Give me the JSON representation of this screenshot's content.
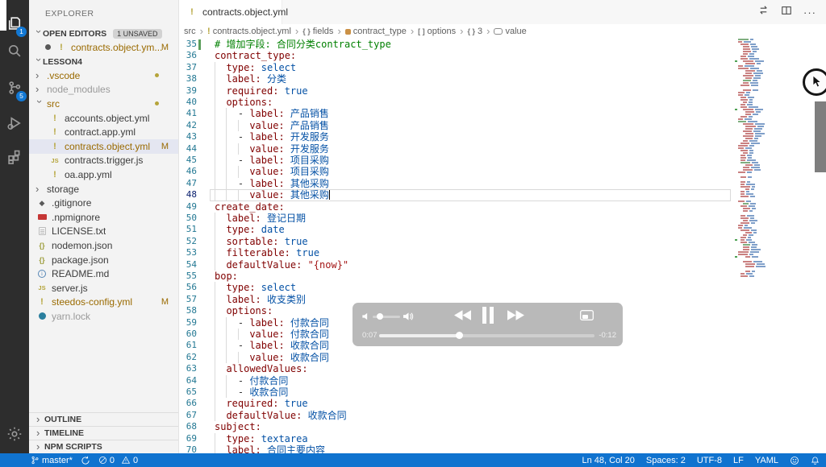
{
  "colors": {
    "status_bar": "#1073cf",
    "activity_badge": "#1278d4",
    "modified": "#9a6a00",
    "comment": "#008000",
    "key": "#800000",
    "value": "#0451a5",
    "string": "#a31515",
    "selection_bg": "#e4e6f1"
  },
  "activity_bar": {
    "items": [
      {
        "name": "explorer",
        "badge": "1",
        "active": true
      },
      {
        "name": "search"
      },
      {
        "name": "source-control",
        "badge": "5"
      },
      {
        "name": "run-debug"
      },
      {
        "name": "extensions"
      }
    ],
    "settings": "gear"
  },
  "sidebar": {
    "title": "EXPLORER",
    "open_editors": {
      "label": "OPEN EDITORS",
      "badge": "1 UNSAVED",
      "items": [
        {
          "label": "contracts.object.ym...",
          "icon": "yaml-icon",
          "modified": true,
          "badge": "M"
        }
      ]
    },
    "section": "LESSON4",
    "tree": [
      {
        "label": ".vscode",
        "chev": "right",
        "color": "mod",
        "dot": true,
        "indent": 0
      },
      {
        "label": "node_modules",
        "chev": "right",
        "color": "dim",
        "indent": 0
      },
      {
        "label": "src",
        "chev": "down",
        "color": "mod",
        "dot": true,
        "indent": 0
      },
      {
        "label": "accounts.object.yml",
        "icon": "yaml",
        "indent": 1
      },
      {
        "label": "contract.app.yml",
        "icon": "yaml",
        "indent": 1
      },
      {
        "label": "contracts.object.yml",
        "icon": "yaml",
        "color": "mod",
        "badge": "M",
        "selected": true,
        "indent": 1
      },
      {
        "label": "contracts.trigger.js",
        "icon": "js",
        "indent": 1
      },
      {
        "label": "oa.app.yml",
        "icon": "yaml",
        "indent": 1
      },
      {
        "label": "storage",
        "chev": "right",
        "indent": 0
      },
      {
        "label": ".gitignore",
        "icon": "git",
        "indent": 0
      },
      {
        "label": ".npmignore",
        "icon": "npm",
        "indent": 0
      },
      {
        "label": "LICENSE.txt",
        "icon": "txt",
        "indent": 0
      },
      {
        "label": "nodemon.json",
        "icon": "json",
        "indent": 0
      },
      {
        "label": "package.json",
        "icon": "json",
        "indent": 0
      },
      {
        "label": "README.md",
        "icon": "info",
        "indent": 0
      },
      {
        "label": "server.js",
        "icon": "js",
        "indent": 0
      },
      {
        "label": "steedos-config.yml",
        "icon": "yaml",
        "color": "mod",
        "badge": "M",
        "indent": 0
      },
      {
        "label": "yarn.lock",
        "icon": "yarn",
        "color": "dim",
        "indent": 0
      }
    ],
    "bottom_sections": [
      "OUTLINE",
      "TIMELINE",
      "NPM SCRIPTS"
    ]
  },
  "editor": {
    "tab": {
      "label": "contracts.object.yml",
      "icon": "yaml-icon",
      "dirty": true
    },
    "breadcrumbs": [
      {
        "label": "src"
      },
      {
        "label": "contracts.object.yml",
        "icon": "yaml"
      },
      {
        "label": "fields",
        "icon": "braces"
      },
      {
        "label": "contract_type",
        "icon": "field"
      },
      {
        "label": "options",
        "icon": "brackets"
      },
      {
        "label": "3",
        "icon": "braces"
      },
      {
        "label": "value",
        "icon": "string"
      }
    ],
    "lines": [
      {
        "n": 35,
        "i": 0,
        "added": true,
        "tokens": [
          [
            "c",
            "# 增加字段: 合同分类contract_type"
          ]
        ]
      },
      {
        "n": 36,
        "i": 0,
        "tokens": [
          [
            "k",
            "contract_type:"
          ]
        ]
      },
      {
        "n": 37,
        "i": 2,
        "tokens": [
          [
            "k",
            "type:"
          ],
          [
            "v",
            " select"
          ]
        ]
      },
      {
        "n": 38,
        "i": 2,
        "tokens": [
          [
            "k",
            "label:"
          ],
          [
            "v",
            " 分类"
          ]
        ]
      },
      {
        "n": 39,
        "i": 2,
        "tokens": [
          [
            "k",
            "required:"
          ],
          [
            "v",
            " true"
          ]
        ]
      },
      {
        "n": 40,
        "i": 2,
        "tokens": [
          [
            "k",
            "options:"
          ]
        ]
      },
      {
        "n": 41,
        "i": 4,
        "tokens": [
          [
            "d",
            "- "
          ],
          [
            "k",
            "label:"
          ],
          [
            "v",
            " 产品销售"
          ]
        ]
      },
      {
        "n": 42,
        "i": 6,
        "tokens": [
          [
            "k",
            "value:"
          ],
          [
            "v",
            " 产品销售"
          ]
        ]
      },
      {
        "n": 43,
        "i": 4,
        "tokens": [
          [
            "d",
            "- "
          ],
          [
            "k",
            "label:"
          ],
          [
            "v",
            " 开发服务"
          ]
        ]
      },
      {
        "n": 44,
        "i": 6,
        "tokens": [
          [
            "k",
            "value:"
          ],
          [
            "v",
            " 开发服务"
          ]
        ]
      },
      {
        "n": 45,
        "i": 4,
        "tokens": [
          [
            "d",
            "- "
          ],
          [
            "k",
            "label:"
          ],
          [
            "v",
            " 项目采购"
          ]
        ]
      },
      {
        "n": 46,
        "i": 6,
        "tokens": [
          [
            "k",
            "value:"
          ],
          [
            "v",
            " 项目采购"
          ]
        ]
      },
      {
        "n": 47,
        "i": 4,
        "tokens": [
          [
            "d",
            "- "
          ],
          [
            "k",
            "label:"
          ],
          [
            "v",
            " 其他采购"
          ]
        ]
      },
      {
        "n": 48,
        "i": 6,
        "current": true,
        "cursor": true,
        "tokens": [
          [
            "k",
            "value:"
          ],
          [
            "v",
            " 其他采购"
          ]
        ]
      },
      {
        "n": 49,
        "i": 0,
        "tokens": [
          [
            "k",
            "create_date:"
          ]
        ]
      },
      {
        "n": 50,
        "i": 2,
        "tokens": [
          [
            "k",
            "label:"
          ],
          [
            "v",
            " 登记日期"
          ]
        ]
      },
      {
        "n": 51,
        "i": 2,
        "tokens": [
          [
            "k",
            "type:"
          ],
          [
            "v",
            " date"
          ]
        ]
      },
      {
        "n": 52,
        "i": 2,
        "tokens": [
          [
            "k",
            "sortable:"
          ],
          [
            "v",
            " true"
          ]
        ]
      },
      {
        "n": 53,
        "i": 2,
        "tokens": [
          [
            "k",
            "filterable:"
          ],
          [
            "v",
            " true"
          ]
        ]
      },
      {
        "n": 54,
        "i": 2,
        "tokens": [
          [
            "k",
            "defaultValue:"
          ],
          [
            "s",
            " \"{now}\""
          ]
        ]
      },
      {
        "n": 55,
        "i": 0,
        "tokens": [
          [
            "k",
            "bop:"
          ]
        ]
      },
      {
        "n": 56,
        "i": 2,
        "tokens": [
          [
            "k",
            "type:"
          ],
          [
            "v",
            " select"
          ]
        ]
      },
      {
        "n": 57,
        "i": 2,
        "tokens": [
          [
            "k",
            "label:"
          ],
          [
            "v",
            " 收支类别"
          ]
        ]
      },
      {
        "n": 58,
        "i": 2,
        "tokens": [
          [
            "k",
            "options:"
          ]
        ]
      },
      {
        "n": 59,
        "i": 4,
        "tokens": [
          [
            "d",
            "- "
          ],
          [
            "k",
            "label:"
          ],
          [
            "v",
            " 付款合同"
          ]
        ]
      },
      {
        "n": 60,
        "i": 6,
        "tokens": [
          [
            "k",
            "value:"
          ],
          [
            "v",
            " 付款合同"
          ]
        ]
      },
      {
        "n": 61,
        "i": 4,
        "tokens": [
          [
            "d",
            "- "
          ],
          [
            "k",
            "label:"
          ],
          [
            "v",
            " 收款合同"
          ]
        ]
      },
      {
        "n": 62,
        "i": 6,
        "tokens": [
          [
            "k",
            "value:"
          ],
          [
            "v",
            " 收款合同"
          ]
        ]
      },
      {
        "n": 63,
        "i": 2,
        "tokens": [
          [
            "k",
            "allowedValues:"
          ]
        ]
      },
      {
        "n": 64,
        "i": 4,
        "tokens": [
          [
            "d",
            "- "
          ],
          [
            "v",
            "付款合同"
          ]
        ]
      },
      {
        "n": 65,
        "i": 4,
        "tokens": [
          [
            "d",
            "- "
          ],
          [
            "v",
            "收款合同"
          ]
        ]
      },
      {
        "n": 66,
        "i": 2,
        "tokens": [
          [
            "k",
            "required:"
          ],
          [
            "v",
            " true"
          ]
        ]
      },
      {
        "n": 67,
        "i": 2,
        "tokens": [
          [
            "k",
            "defaultValue:"
          ],
          [
            "v",
            " 收款合同"
          ]
        ]
      },
      {
        "n": 68,
        "i": 0,
        "tokens": [
          [
            "k",
            "subject:"
          ]
        ]
      },
      {
        "n": 69,
        "i": 2,
        "tokens": [
          [
            "k",
            "type:"
          ],
          [
            "v",
            " textarea"
          ]
        ]
      },
      {
        "n": 70,
        "i": 2,
        "tokens": [
          [
            "k",
            "label:"
          ],
          [
            "v",
            " 合同主要内容"
          ]
        ]
      }
    ]
  },
  "player": {
    "elapsed": "0:07",
    "remaining": "-0:12",
    "progress_pct": 37,
    "volume_pct": 20,
    "icons": [
      "volume-low-icon",
      "volume-high-icon",
      "rewind-icon",
      "pause-icon",
      "fast-forward-icon",
      "pip-icon",
      "shrink-icon"
    ]
  },
  "status_bar": {
    "branch": "master*",
    "errors": "0",
    "warnings": "0",
    "cursor_position": "Ln 48, Col 20",
    "indentation": "Spaces: 2",
    "encoding": "UTF-8",
    "eol": "LF",
    "language": "YAML",
    "icons": [
      "git-branch-icon",
      "sync-icon",
      "error-icon",
      "warning-icon",
      "feedback-icon",
      "bell-icon"
    ]
  }
}
